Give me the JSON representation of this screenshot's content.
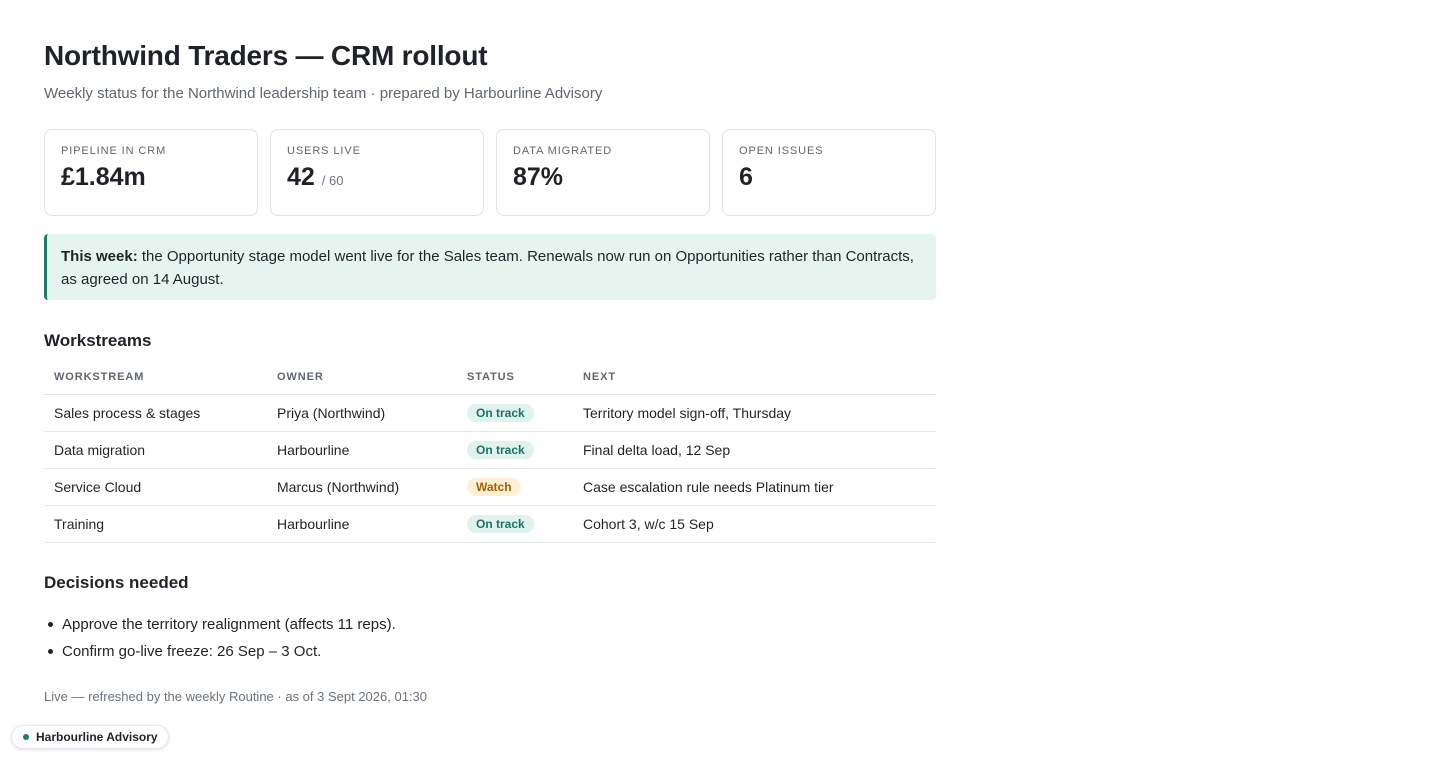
{
  "header": {
    "title": "Northwind Traders — CRM rollout",
    "subtitle": "Weekly status for the Northwind leadership team · prepared by Harbourline Advisory"
  },
  "metrics": [
    {
      "label": "PIPELINE IN CRM",
      "value": "£1.84m",
      "sub": ""
    },
    {
      "label": "USERS LIVE",
      "value": "42",
      "sub": "/ 60"
    },
    {
      "label": "DATA MIGRATED",
      "value": "87%",
      "sub": ""
    },
    {
      "label": "OPEN ISSUES",
      "value": "6",
      "sub": ""
    }
  ],
  "callout": {
    "lead": "This week:",
    "text": " the Opportunity stage model went live for the Sales team. Renewals now run on Opportunities rather than Contracts, as agreed on 14 August."
  },
  "workstreams": {
    "heading": "Workstreams",
    "columns": [
      "WORKSTREAM",
      "OWNER",
      "STATUS",
      "NEXT"
    ],
    "rows": [
      {
        "workstream": "Sales process & stages",
        "owner": "Priya (Northwind)",
        "status": "On track",
        "status_kind": "ok",
        "next": "Territory model sign-off, Thursday"
      },
      {
        "workstream": "Data migration",
        "owner": "Harbourline",
        "status": "On track",
        "status_kind": "ok",
        "next": "Final delta load, 12 Sep"
      },
      {
        "workstream": "Service Cloud",
        "owner": "Marcus (Northwind)",
        "status": "Watch",
        "status_kind": "warn",
        "next": "Case escalation rule needs Platinum tier"
      },
      {
        "workstream": "Training",
        "owner": "Harbourline",
        "status": "On track",
        "status_kind": "ok",
        "next": "Cohort 3, w/c 15 Sep"
      }
    ]
  },
  "decisions": {
    "heading": "Decisions needed",
    "items": [
      "Approve the territory realignment (affects 11 reps).",
      "Confirm go-live freeze: 26 Sep – 3 Oct."
    ]
  },
  "footer": {
    "note": "Live — refreshed by the weekly Routine · as of 3 Sept 2026, 01:30",
    "badge": "Harbourline Advisory"
  },
  "colors": {
    "accent": "#1f7a6a",
    "ok_bg": "#e0f2ee",
    "warn_bg": "#fdf0d5",
    "callout_bg": "#e6f4f0"
  }
}
